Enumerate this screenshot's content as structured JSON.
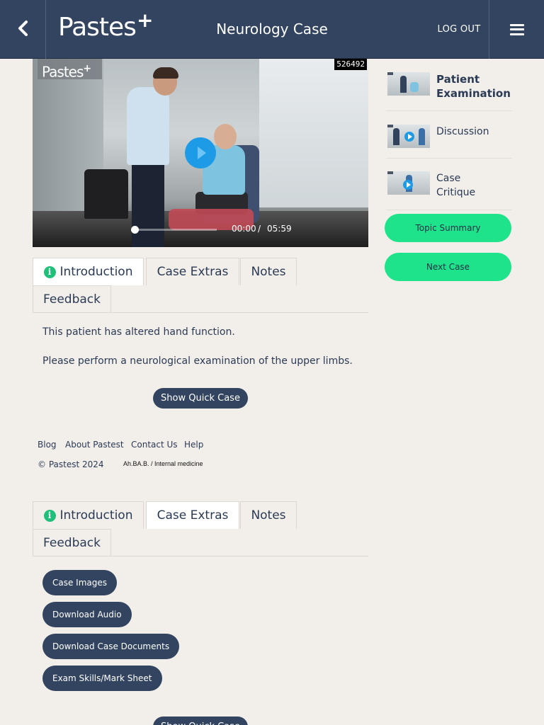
{
  "header": {
    "back_icon": "chevron-left-icon",
    "logo_text": "Pastes",
    "logo_plus": "+",
    "title": "Neurology Case",
    "logout_label": "LOG OUT",
    "menu_icon": "hamburger-menu-icon"
  },
  "video": {
    "logo_text": "Pastes",
    "logo_plus": "+",
    "id_badge": "526492",
    "current_time": "00:00",
    "separator": "/",
    "total_time": "05:59",
    "progress": 0
  },
  "tabs_top": {
    "items": [
      {
        "label": "Introduction",
        "active": true
      },
      {
        "label": "Case Extras",
        "active": false
      },
      {
        "label": "Notes",
        "active": false
      },
      {
        "label": "Feedback",
        "active": false
      }
    ]
  },
  "introduction": {
    "line1": "This patient has altered hand function.",
    "line2": "Please perform a neurological examination of the upper limbs.",
    "show_quick_case": "Show Quick Case"
  },
  "footer": {
    "links": [
      "Blog",
      "About Pastest",
      "Contact Us",
      "Help"
    ],
    "copyright": "© Pastest 2024",
    "build_tag": "Ah.BA.B. / Internal medicine"
  },
  "tabs_bottom": {
    "items": [
      {
        "label": "Introduction",
        "active": false
      },
      {
        "label": "Case Extras",
        "active": true
      },
      {
        "label": "Notes",
        "active": false
      },
      {
        "label": "Feedback",
        "active": false
      }
    ]
  },
  "case_extras": {
    "buttons": [
      "Case Images",
      "Download Audio",
      "Download Case Documents",
      "Exam Skills/Mark Sheet"
    ],
    "show_quick_case": "Show Quick Case"
  },
  "sidebar": {
    "items": [
      {
        "label_line1": "Patient",
        "label_line2": "Examination",
        "active": true
      },
      {
        "label_line1": "Discussion",
        "label_line2": "",
        "active": false
      },
      {
        "label_line1": "Case",
        "label_line2": "Critique",
        "active": false
      }
    ],
    "topic_summary": "Topic Summary",
    "next_case": "Next Case"
  },
  "colors": {
    "header_bg": "#32445f",
    "page_bg": "#f2efea",
    "accent_green": "#1ee38a",
    "play_blue": "#1d9be6",
    "info_green": "#20c07a"
  }
}
